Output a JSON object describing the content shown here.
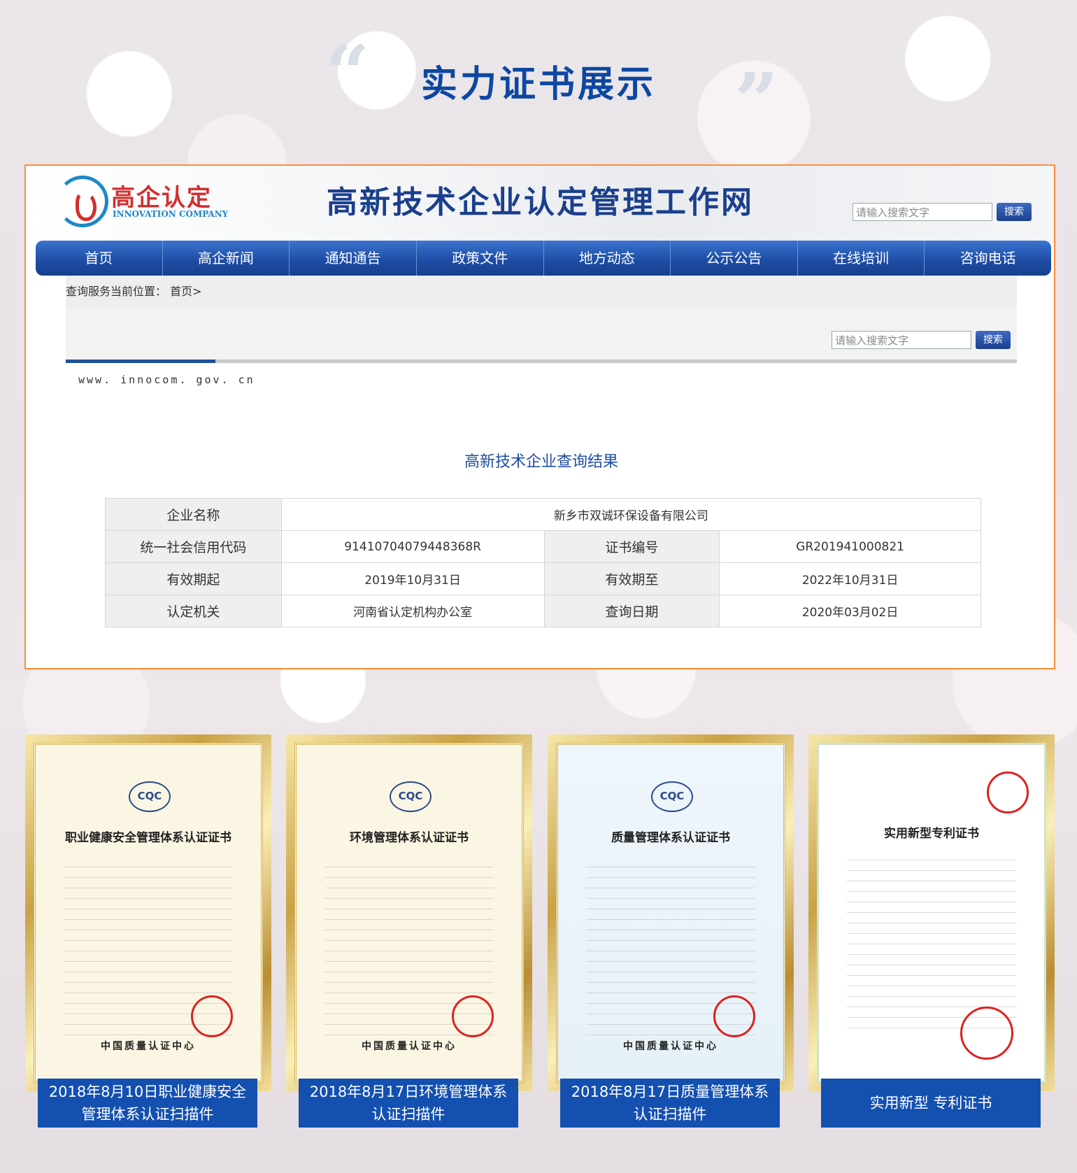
{
  "page": {
    "title": "实力证书展示",
    "quote_open": "“",
    "quote_close": "”"
  },
  "site": {
    "logo_cn": "高企认定",
    "logo_en": "INNOVATION COMPANY",
    "title": "高新技术企业认定管理工作网",
    "search_placeholder": "请输入搜索文字",
    "search_button": "搜索",
    "nav": [
      "首页",
      "高企新闻",
      "通知通告",
      "政策文件",
      "地方动态",
      "公示公告",
      "在线培训",
      "咨询电话"
    ],
    "breadcrumb_label": "查询服务当前位置：",
    "breadcrumb_home": "首页>",
    "content_search_placeholder": "请输入搜索文字",
    "content_search_button": "搜索",
    "url": "www. innocom. gov. cn",
    "result_title": "高新技术企业查询结果"
  },
  "result": {
    "company_label": "企业名称",
    "company_value": "新乡市双诚环保设备有限公司",
    "rows": [
      {
        "l1": "统一社会信用代码",
        "v1": "91410704079448368R",
        "l2": "证书编号",
        "v2": "GR201941000821"
      },
      {
        "l1": "有效期起",
        "v1": "2019年10月31日",
        "l2": "有效期至",
        "v2": "2022年10月31日"
      },
      {
        "l1": "认定机关",
        "v1": "河南省认定机构办公室",
        "l2": "查询日期",
        "v2": "2020年03月02日"
      }
    ]
  },
  "certificates": [
    {
      "heading": "职业健康安全管理体系认证证书",
      "logo": "CQC",
      "footer": "中国质量认证中心",
      "caption": "2018年8月10日职业健康安全管理体系认证扫描件"
    },
    {
      "heading": "环境管理体系认证证书",
      "logo": "CQC",
      "footer": "中国质量认证中心",
      "caption": "2018年8月17日环境管理体系认证扫描件"
    },
    {
      "heading": "质量管理体系认证证书",
      "logo": "CQC",
      "footer": "中国质量认证中心",
      "caption": "2018年8月17日质量管理体系认证扫描件"
    },
    {
      "heading": "实用新型专利证书",
      "logo": "",
      "footer": "",
      "caption": "实用新型 专利证书"
    }
  ]
}
